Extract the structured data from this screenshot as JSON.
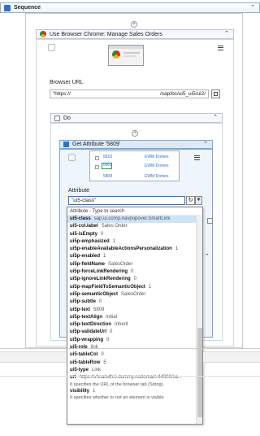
{
  "sequence": {
    "title": "Sequence"
  },
  "browser": {
    "title": "Use Browser Chrome: Manage Sales Orders",
    "url_label": "Browser URL",
    "url_value_start": "\"https://",
    "url_value_end": "/sap/bc/ui5_ui5/ui2/"
  },
  "do_block": {
    "title": "Do"
  },
  "get_attr": {
    "title": "Get Attribute '5809'",
    "thumb_rows": [
      {
        "id": "5810",
        "label": "EWM Domes"
      },
      {
        "id": "5809",
        "label": "EWM Domes"
      },
      {
        "id": "5808",
        "label": "EWM Domes"
      }
    ],
    "attribute_label": "Attribute",
    "attribute_value": "\"ui5-class\""
  },
  "dropdown": {
    "header": "Attribute - Type to search",
    "items": [
      {
        "name": "ui5-class",
        "value": "sap.ui.comp.navpopover.SmartLink"
      },
      {
        "name": "ui5-col.label",
        "value": "Sales Order"
      },
      {
        "name": "ui5-isEmpty",
        "value": "0"
      },
      {
        "name": "ui5p-emphasized",
        "value": "1"
      },
      {
        "name": "ui5p-enableAvailableActionsPersonalization",
        "value": "1"
      },
      {
        "name": "ui5p-enabled",
        "value": "1"
      },
      {
        "name": "ui5p-fieldName",
        "value": "SalesOrder"
      },
      {
        "name": "ui5p-forceLinkRendering",
        "value": "0"
      },
      {
        "name": "ui5p-ignoreLinkRendering",
        "value": "0"
      },
      {
        "name": "ui5p-mapFieldToSemanticObject",
        "value": "1"
      },
      {
        "name": "ui5p-semanticObject",
        "value": "SalesOrder"
      },
      {
        "name": "ui5p-subtle",
        "value": "0"
      },
      {
        "name": "ui5p-text",
        "value": "5809"
      },
      {
        "name": "ui5p-textAlign",
        "value": "Initial"
      },
      {
        "name": "ui5p-textDirection",
        "value": "Inherit"
      },
      {
        "name": "ui5p-validateUrl",
        "value": "0"
      },
      {
        "name": "ui5p-wrapping",
        "value": "0"
      },
      {
        "name": "ui5-role",
        "value": "link"
      },
      {
        "name": "ui5-tableCol",
        "value": "0"
      },
      {
        "name": "ui5-tableRow",
        "value": "5"
      },
      {
        "name": "ui5-type",
        "value": "Link"
      },
      {
        "name": "url",
        "value": "https://vhcals4hci.dummy.nodomain:44300/sa..."
      }
    ],
    "url_desc": "It specifies the URL of the browser tab (String).",
    "visibility": {
      "name": "visibility",
      "value": "1"
    },
    "visibility_desc": "It specifies whether or not an element is visible"
  },
  "colors": {
    "accent": "#2e73c7",
    "header_border": "#8fb0d0",
    "selected_bg": "#cde3f7"
  }
}
